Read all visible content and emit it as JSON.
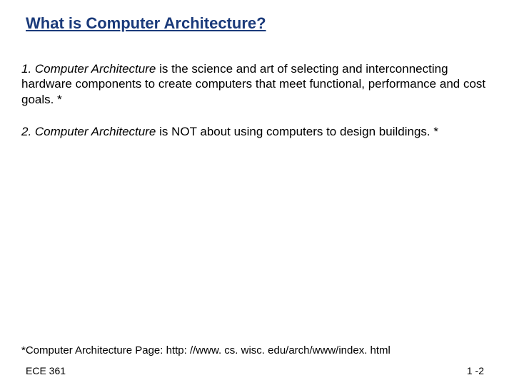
{
  "title": "What is Computer Architecture?",
  "point1": {
    "prefix": "1. Computer Architecture",
    "rest": " is the science and art of selecting and interconnecting hardware components to create computers that meet functional, performance and cost goals. *"
  },
  "point2": {
    "prefix": "2. Computer Architecture",
    "rest": " is NOT about using computers to design buildings. *"
  },
  "footnote": "*Computer Architecture Page: http: //www. cs. wisc. edu/arch/www/index. html",
  "footer_left": "ECE 361",
  "footer_right": "1 -2"
}
